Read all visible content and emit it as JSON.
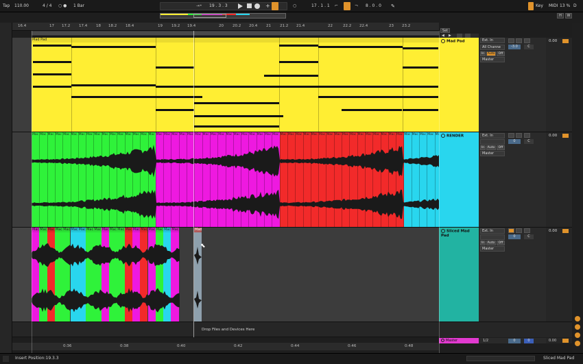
{
  "control_bar": {
    "tap": "Tap",
    "tempo": "110.00",
    "meter": "4 / 4",
    "metronome": "○ ●",
    "quantize": "1 Bar",
    "arrangement_position": "19 .  3 .  3",
    "loop_start": "17 .  1 .  1",
    "loop_length": "8 .  0 .  0",
    "key_label": "Key",
    "midi_label": "MIDI",
    "cpu_label": "13 %",
    "disk_label": "D"
  },
  "ruler": {
    "ticks": [
      "16.4",
      "17",
      "17.2",
      "17.4",
      "18",
      "18.2",
      "18.4",
      "19",
      "19.2",
      "19.4",
      "20",
      "20.2",
      "20.4",
      "21",
      "21.2",
      "21.4",
      "22",
      "22.2",
      "22.4",
      "23",
      "23.2"
    ]
  },
  "set_button": "Set",
  "tracks": [
    {
      "name": "Mad Pad",
      "clip_title": "Mad Pad",
      "color": "#ffee33",
      "input": "Ext. In",
      "channel": "All Channe",
      "monitor_in": "In",
      "monitor_auto": "Auto",
      "monitor_off": "Off",
      "output": "Master",
      "volume": "-3.0",
      "pan": "C",
      "send": "0.00"
    },
    {
      "name": "RENDER",
      "color": "#29d6ee",
      "input": "Ext. In",
      "monitor_in": "In",
      "monitor_auto": "Auto",
      "monitor_off": "Off",
      "output": "Master",
      "volume": "0",
      "pan": "C",
      "send": "0.00",
      "slice_label": "Mac"
    },
    {
      "name": "Sliced Mad Pad",
      "color": "#22b3a2",
      "input": "Ext. In",
      "monitor_in": "In",
      "monitor_auto": "Auto",
      "monitor_off": "Off",
      "output": "Master",
      "volume": "0",
      "pan": "C",
      "send": "0.00",
      "slice_label": "Mac",
      "dragged_clip_label": "Mad"
    }
  ],
  "drop_zone_text": "Drop Files and Devices Here",
  "master": {
    "name": "Master",
    "color": "#e23ad0",
    "fraction": "1/2",
    "value_a": "0",
    "value_b": "0",
    "send": "0.00"
  },
  "time_ticks": [
    "0:36",
    "0:38",
    "0:40",
    "0:42",
    "0:44",
    "0:46",
    "0:48"
  ],
  "status": {
    "insert_position": "Insert Position:19.3.3",
    "selected_track": "Sliced Mad Pad"
  },
  "colors": {
    "yellow": "#ffee33",
    "green": "#2ff23a",
    "magenta": "#ee19e0",
    "red": "#f22a2a",
    "cyan": "#29d6ee",
    "orange": "#e0932b"
  }
}
